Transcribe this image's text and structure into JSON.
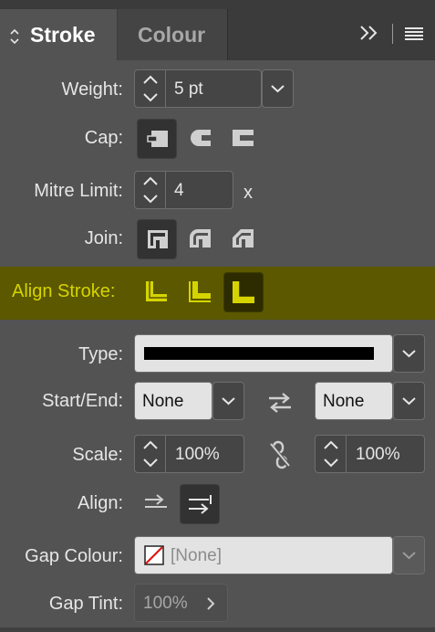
{
  "tabs": {
    "stroke_label": "Stroke",
    "colour_label": "Colour"
  },
  "weight": {
    "label": "Weight:",
    "value": "5 pt"
  },
  "cap": {
    "label": "Cap:",
    "options": [
      "butt-cap-icon",
      "round-cap-icon",
      "projecting-cap-icon"
    ],
    "selected": 0
  },
  "mitre": {
    "label": "Mitre Limit:",
    "value": "4",
    "unit": "x"
  },
  "join": {
    "label": "Join:",
    "options": [
      "miter-join-icon",
      "round-join-icon",
      "bevel-join-icon"
    ],
    "selected": 0
  },
  "align_stroke": {
    "label": "Align Stroke:",
    "options": [
      "align-center-icon",
      "align-inside-icon",
      "align-outside-icon"
    ],
    "selected": 2,
    "highlight_color": "#d6d400"
  },
  "type": {
    "label": "Type:"
  },
  "start_end": {
    "label": "Start/End:",
    "start": "None",
    "end": "None"
  },
  "scale": {
    "label": "Scale:",
    "start": "100%",
    "end": "100%"
  },
  "align": {
    "label": "Align:",
    "selected": 1
  },
  "gap_colour": {
    "label": "Gap Colour:",
    "value": "[None]"
  },
  "gap_tint": {
    "label": "Gap Tint:",
    "value": "100%"
  }
}
